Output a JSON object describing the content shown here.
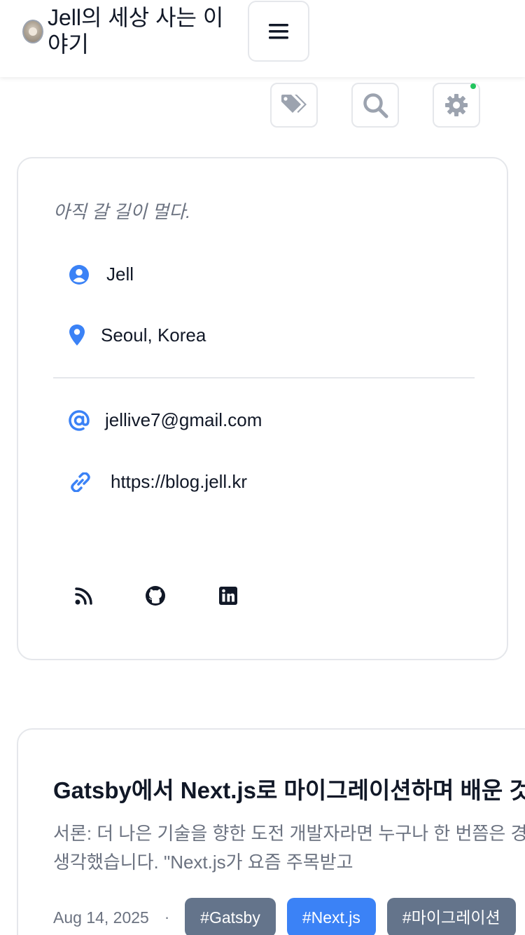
{
  "header": {
    "title": "Jell의 세상 사는 이야기"
  },
  "toolbar": {
    "icons": [
      "tag-icon",
      "search-icon",
      "gear-icon"
    ],
    "status_color": "#22c55e"
  },
  "profile": {
    "bio": "아직 갈 길이 멀다.",
    "name": "Jell",
    "location": "Seoul, Korea",
    "email": "jellive7@gmail.com",
    "website": "https://blog.jell.kr",
    "social_icons": [
      "rss-icon",
      "github-icon",
      "linkedin-icon"
    ],
    "accent_color": "#3b82f6"
  },
  "post": {
    "title": "Gatsby에서 Next.js로 마이그레이션하며 배운 것",
    "excerpt_line1": "서론: 더 나은 기술을 향한 도전 개발자라면 누구나 한 번쯤은 경",
    "excerpt_line2": "생각했습니다. \"Next.js가 요즘 주목받고",
    "date": "Aug 14, 2025",
    "separator": "·",
    "tags": [
      "#Gatsby",
      "#Next.js",
      "#마이그레이션"
    ]
  }
}
